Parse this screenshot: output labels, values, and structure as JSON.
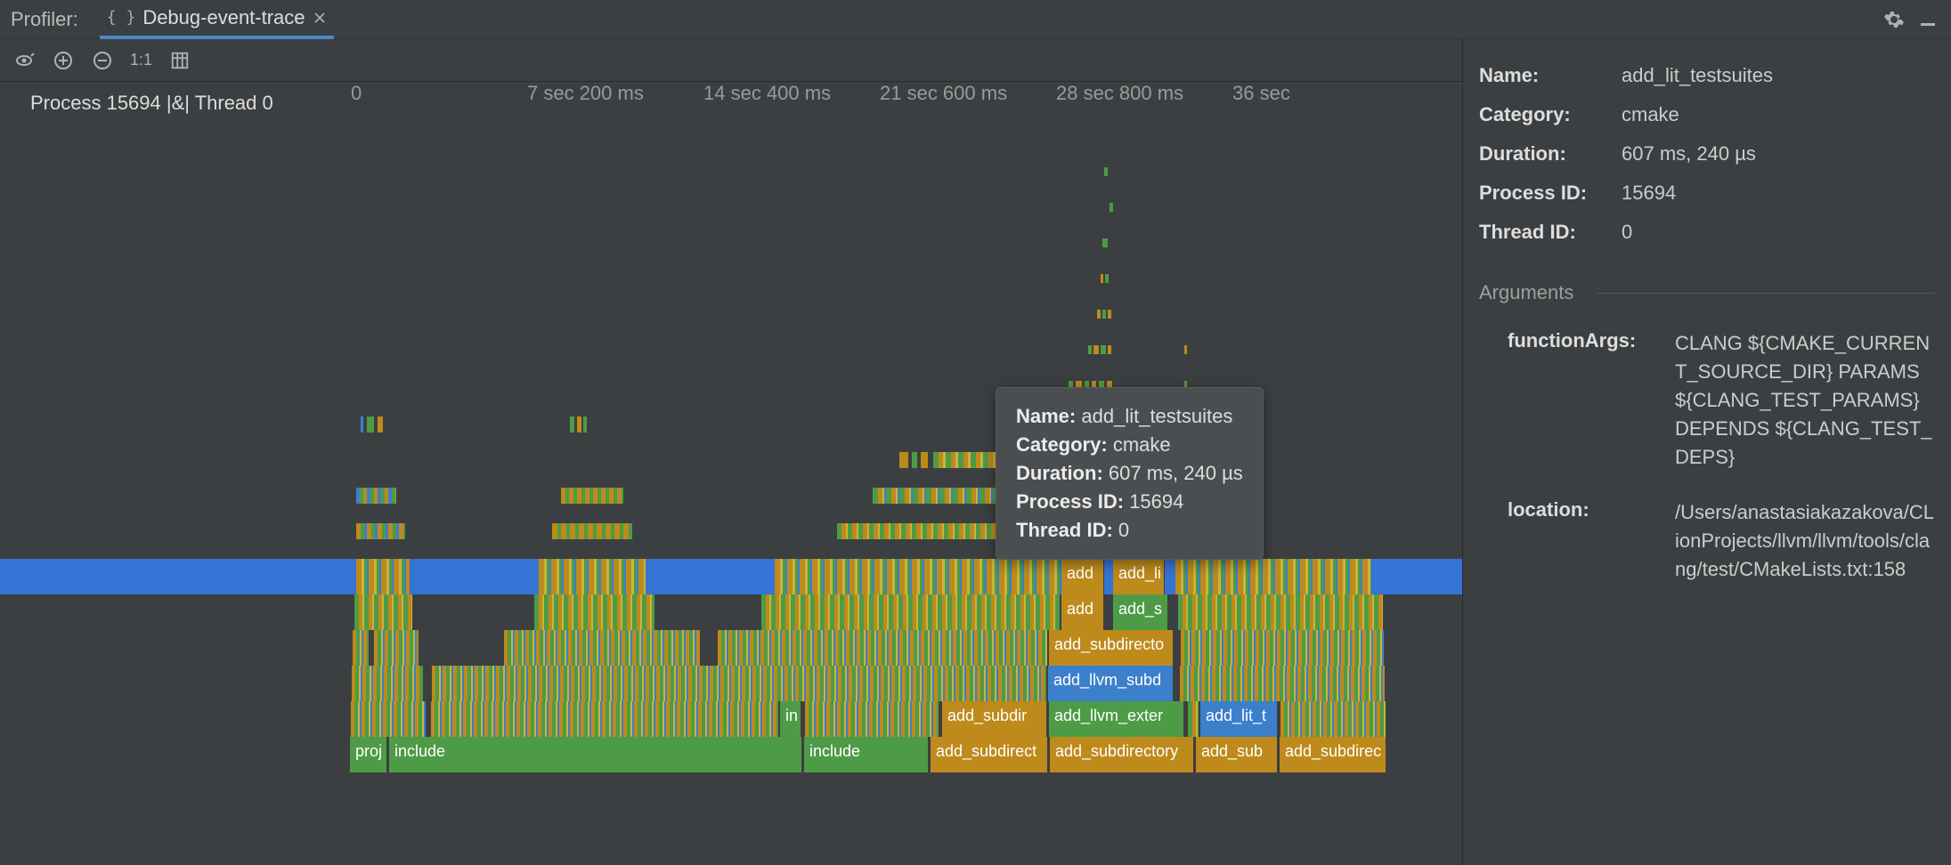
{
  "header": {
    "title": "Profiler:",
    "tab_icon": "{ }",
    "tab_label": "Debug-event-trace"
  },
  "ruler": {
    "ticks": [
      "0",
      "7 sec 200 ms",
      "14 sec 400 ms",
      "21 sec 600 ms",
      "28 sec 800 ms",
      "36 sec"
    ]
  },
  "process_label": "Process 15694 |&| Thread 0",
  "tooltip": {
    "name_k": "Name:",
    "name_v": "add_lit_testsuites",
    "cat_k": "Category:",
    "cat_v": "cmake",
    "dur_k": "Duration:",
    "dur_v": "607 ms, 240 µs",
    "pid_k": "Process ID:",
    "pid_v": "15694",
    "tid_k": "Thread ID:",
    "tid_v": "0"
  },
  "flame": {
    "row_sel_1": "add",
    "row_sel_2": "add_li",
    "r2_1": "add",
    "r2_2": "add_s",
    "r3_1": "add_subdirecto",
    "r4_1": "add_llvm_subd",
    "r5_1": "in",
    "r5_2": "add_subdir",
    "r5_3": "add_llvm_exter",
    "r5_4": "add_lit_t",
    "r6_1": "proj",
    "r6_2": "include",
    "r6_3": "include",
    "r6_4": "add_subdirect",
    "r6_5": "add_subdirectory",
    "r6_6": "add_sub",
    "r6_7": "add_subdirec"
  },
  "details": {
    "name_k": "Name:",
    "name_v": "add_lit_testsuites",
    "cat_k": "Category:",
    "cat_v": "cmake",
    "dur_k": "Duration:",
    "dur_v": "607 ms, 240 µs",
    "pid_k": "Process ID:",
    "pid_v": "15694",
    "tid_k": "Thread ID:",
    "tid_v": "0"
  },
  "arguments": {
    "section": "Arguments",
    "fa_k": "functionArgs:",
    "fa_v": "CLANG ${CMAKE_CURRENT_SOURCE_DIR} PARAMS ${CLANG_TEST_PARAMS} DEPENDS ${CLANG_TEST_DEPS}",
    "loc_k": "location:",
    "loc_v": "/Users/anastasiakazakova/CLionProjects/llvm/llvm/tools/clang/test/CMakeLists.txt:158"
  },
  "icons": {
    "toolbar_1_1": "1:1"
  }
}
